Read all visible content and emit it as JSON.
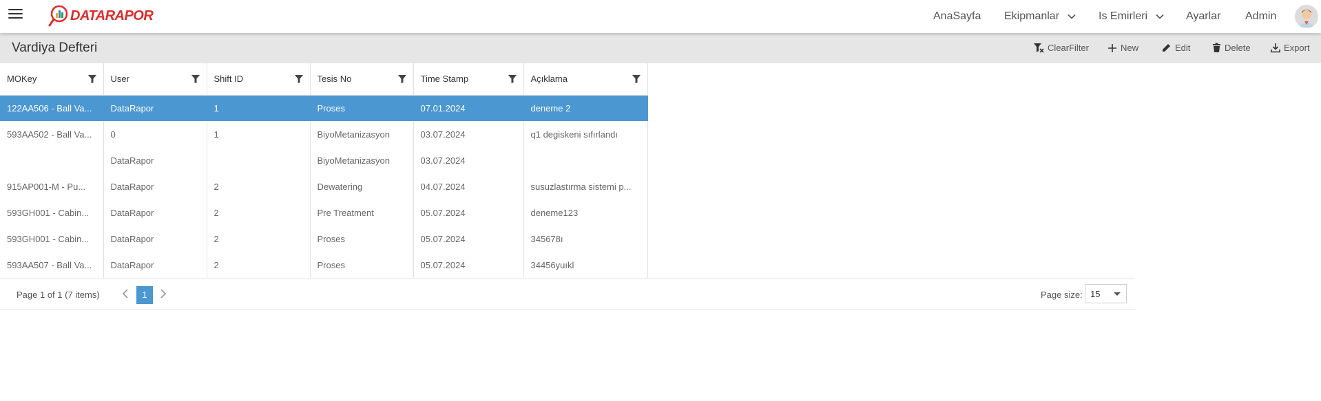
{
  "navbar": {
    "logo_text": "DATARAPOR",
    "items": [
      {
        "label": "AnaSayfa",
        "has_dropdown": false
      },
      {
        "label": "Ekipmanlar",
        "has_dropdown": true
      },
      {
        "label": "Is Emirleri",
        "has_dropdown": true
      },
      {
        "label": "Ayarlar",
        "has_dropdown": false
      },
      {
        "label": "Admin",
        "has_dropdown": false
      }
    ],
    "avatar_icon": "user-avatar-icon"
  },
  "toolbar": {
    "title": "Vardiya Defteri",
    "buttons": [
      {
        "label": "ClearFilter",
        "icon": "clear-filter-icon"
      },
      {
        "label": "New",
        "icon": "plus-icon"
      },
      {
        "label": "Edit",
        "icon": "pencil-icon"
      },
      {
        "label": "Delete",
        "icon": "trash-icon"
      },
      {
        "label": "Export",
        "icon": "download-icon"
      }
    ]
  },
  "grid": {
    "columns": [
      "MOKey",
      "User",
      "Shift ID",
      "Tesis No",
      "Time Stamp",
      "Açıklama"
    ],
    "rows": [
      [
        "122AA506 - Ball Va...",
        "DataRapor",
        "1",
        "Proses",
        "07.01.2024",
        "deneme 2"
      ],
      [
        "593AA502 - Ball Va...",
        "0",
        "1",
        "BiyoMetanizasyon",
        "03.07.2024",
        "q1 degiskeni sıfırlandı"
      ],
      [
        "",
        "DataRapor",
        "",
        "BiyoMetanizasyon",
        "03.07.2024",
        ""
      ],
      [
        "915AP001-M - Pu...",
        "DataRapor",
        "2",
        "Dewatering",
        "04.07.2024",
        "susuzlastırma sistemi p..."
      ],
      [
        "593GH001 - Cabin...",
        "DataRapor",
        "2",
        "Pre Treatment",
        "05.07.2024",
        "deneme123"
      ],
      [
        "593GH001 - Cabin...",
        "DataRapor",
        "2",
        "Proses",
        "05.07.2024",
        "345678ı"
      ],
      [
        "593AA507 - Ball Va...",
        "DataRapor",
        "2",
        "Proses",
        "05.07.2024",
        "34456yuıkl"
      ]
    ],
    "selected_row": 0,
    "selected_color": "#4a97d2"
  },
  "pager": {
    "info": "Page 1 of 1 (7 items)",
    "current_page": "1",
    "page_size_label": "Page size:",
    "page_size_value": "15"
  }
}
